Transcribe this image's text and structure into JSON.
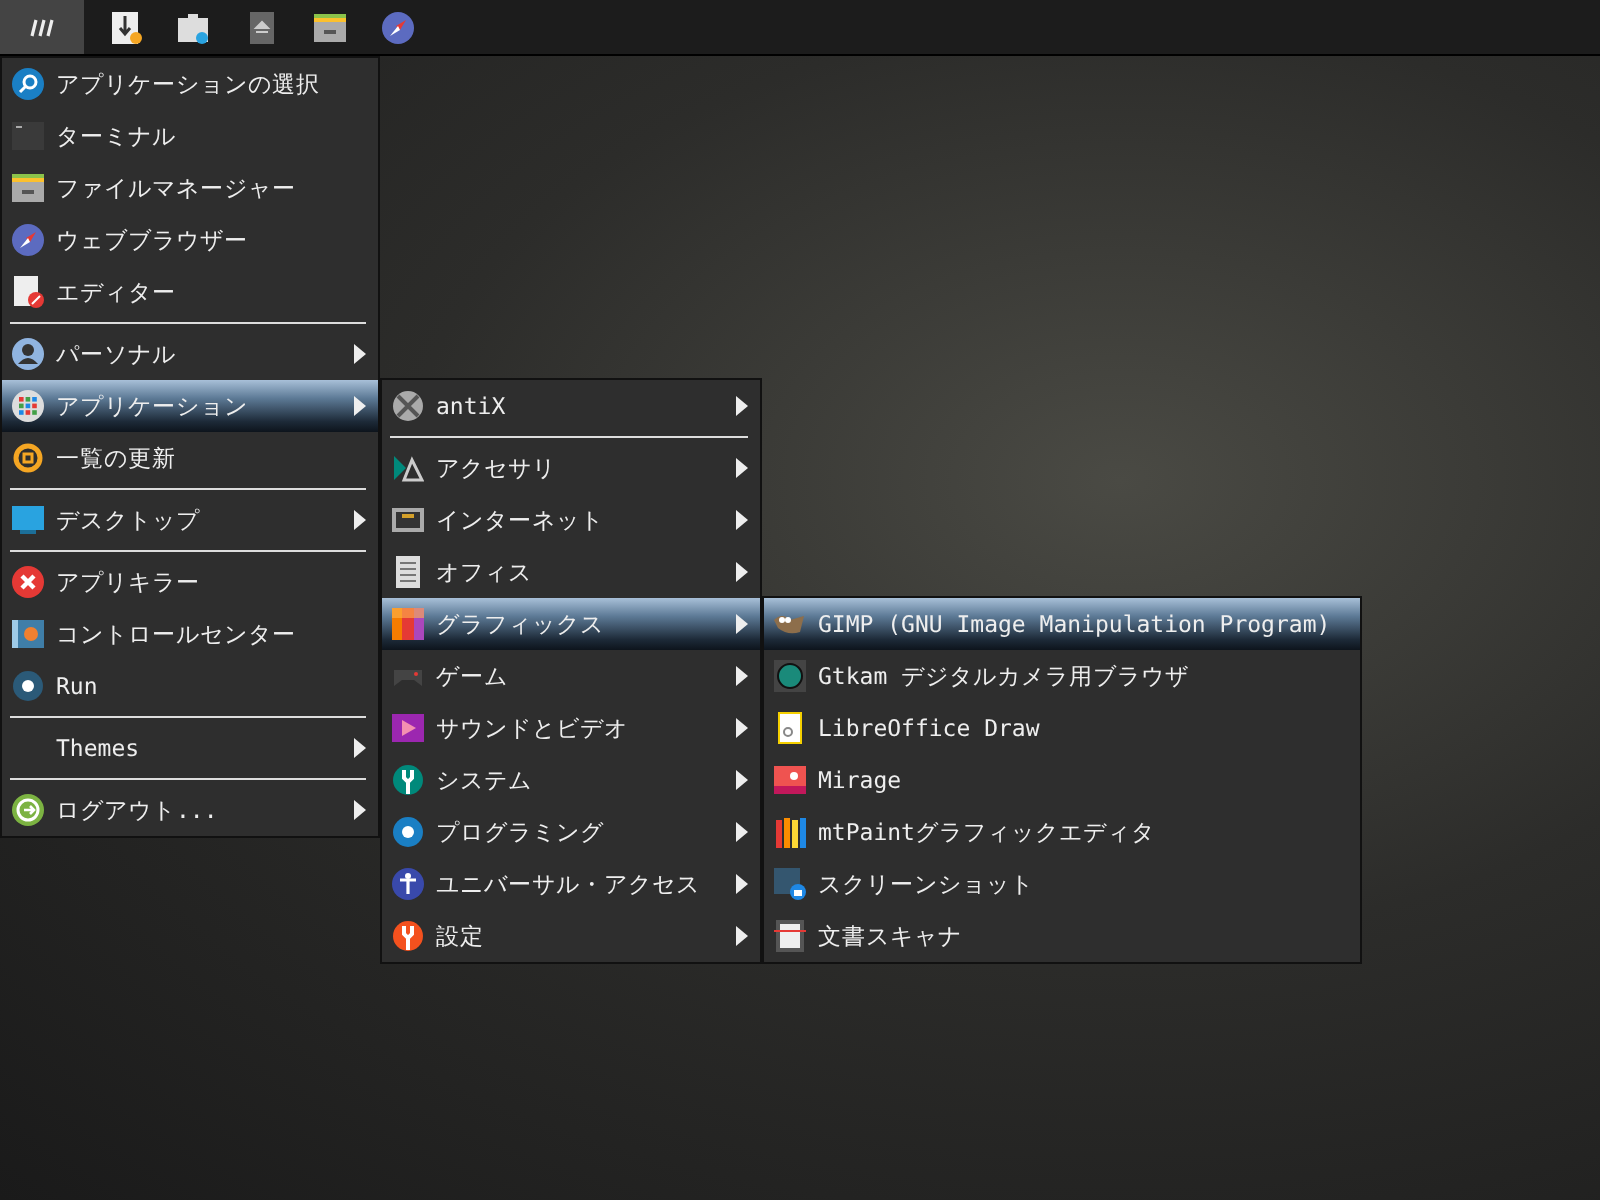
{
  "taskbar": {
    "launchers": [
      {
        "selected": true
      },
      {
        "selected": false
      },
      {
        "selected": false
      },
      {
        "selected": false
      },
      {
        "selected": false
      },
      {
        "selected": false
      }
    ]
  },
  "menus": [
    {
      "items": [
        {
          "kind": "item",
          "label": "アプリケーションの選択",
          "submenu": false,
          "selected": false
        },
        {
          "kind": "item",
          "label": "ターミナル",
          "submenu": false,
          "selected": false
        },
        {
          "kind": "item",
          "label": "ファイルマネージャー",
          "submenu": false,
          "selected": false
        },
        {
          "kind": "item",
          "label": "ウェブブラウザー",
          "submenu": false,
          "selected": false
        },
        {
          "kind": "item",
          "label": "エディター",
          "submenu": false,
          "selected": false
        },
        {
          "kind": "separator"
        },
        {
          "kind": "item",
          "label": "パーソナル",
          "submenu": true,
          "selected": false
        },
        {
          "kind": "item",
          "label": "アプリケーション",
          "submenu": true,
          "selected": true
        },
        {
          "kind": "item",
          "label": "一覧の更新",
          "submenu": false,
          "selected": false
        },
        {
          "kind": "separator"
        },
        {
          "kind": "item",
          "label": "デスクトップ",
          "submenu": true,
          "selected": false
        },
        {
          "kind": "separator"
        },
        {
          "kind": "item",
          "label": "アプリキラー",
          "submenu": false,
          "selected": false
        },
        {
          "kind": "item",
          "label": "コントロールセンター",
          "submenu": false,
          "selected": false
        },
        {
          "kind": "item",
          "label": "Run",
          "submenu": false,
          "selected": false
        },
        {
          "kind": "separator"
        },
        {
          "kind": "item",
          "label": "Themes",
          "submenu": true,
          "selected": false
        },
        {
          "kind": "separator"
        },
        {
          "kind": "item",
          "label": "ログアウト...",
          "submenu": true,
          "selected": false
        }
      ]
    },
    {
      "items": [
        {
          "kind": "item",
          "label": "antiX",
          "submenu": true,
          "selected": false
        },
        {
          "kind": "separator"
        },
        {
          "kind": "item",
          "label": "アクセサリ",
          "submenu": true,
          "selected": false
        },
        {
          "kind": "item",
          "label": "インターネット",
          "submenu": true,
          "selected": false
        },
        {
          "kind": "item",
          "label": "オフィス",
          "submenu": true,
          "selected": false
        },
        {
          "kind": "item",
          "label": "グラフィックス",
          "submenu": true,
          "selected": true
        },
        {
          "kind": "item",
          "label": "ゲーム",
          "submenu": true,
          "selected": false
        },
        {
          "kind": "item",
          "label": "サウンドとビデオ",
          "submenu": true,
          "selected": false
        },
        {
          "kind": "item",
          "label": "システム",
          "submenu": true,
          "selected": false
        },
        {
          "kind": "item",
          "label": "プログラミング",
          "submenu": true,
          "selected": false
        },
        {
          "kind": "item",
          "label": "ユニバーサル・アクセス",
          "submenu": true,
          "selected": false
        },
        {
          "kind": "item",
          "label": "設定",
          "submenu": true,
          "selected": false
        }
      ]
    },
    {
      "items": [
        {
          "kind": "item",
          "label": "GIMP (GNU Image Manipulation Program)",
          "submenu": false,
          "selected": true
        },
        {
          "kind": "item",
          "label": "Gtkam デジタルカメラ用ブラウザ",
          "submenu": false,
          "selected": false
        },
        {
          "kind": "item",
          "label": "LibreOffice Draw",
          "submenu": false,
          "selected": false
        },
        {
          "kind": "item",
          "label": "Mirage",
          "submenu": false,
          "selected": false
        },
        {
          "kind": "item",
          "label": "mtPaintグラフィックエディタ",
          "submenu": false,
          "selected": false
        },
        {
          "kind": "item",
          "label": "スクリーンショット",
          "submenu": false,
          "selected": false
        },
        {
          "kind": "item",
          "label": "文書スキャナ",
          "submenu": false,
          "selected": false
        }
      ]
    }
  ]
}
